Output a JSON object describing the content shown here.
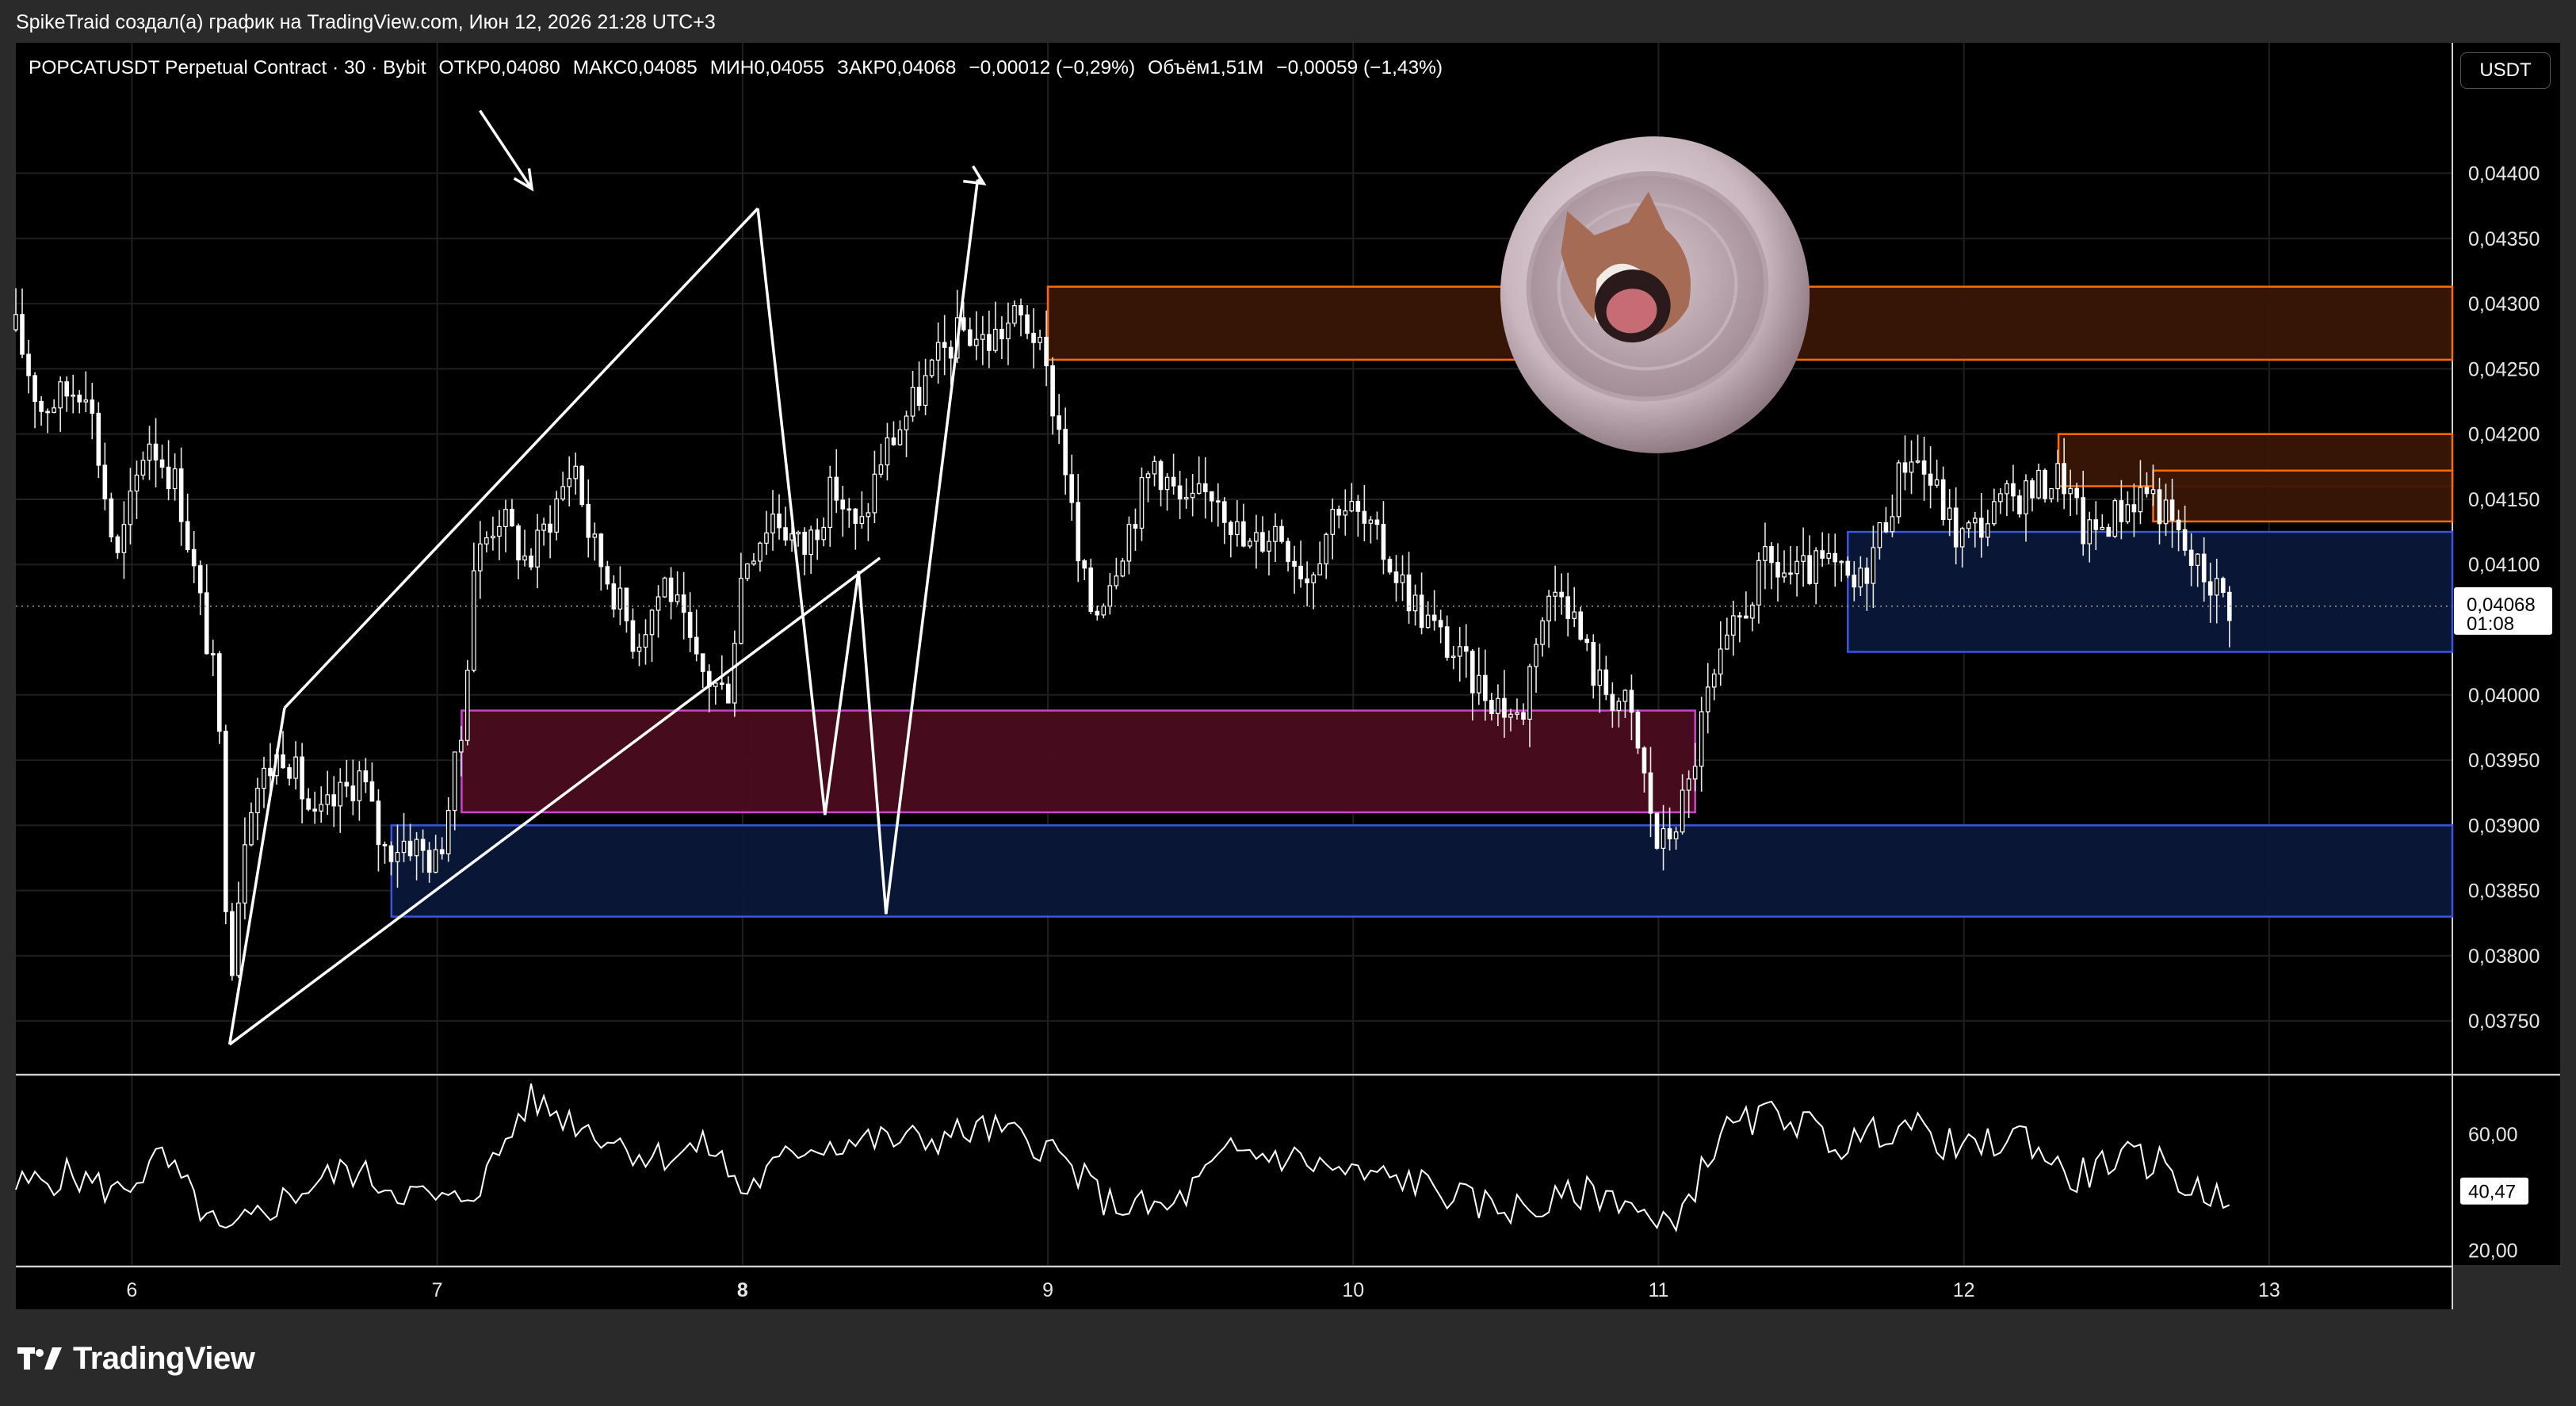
{
  "credit": "SpikeTraid создал(а) график на TradingView.com, Июн 12, 2026 21:28 UTC+3",
  "legend": {
    "symbol": "POPCATUSDT Perpetual Contract · 30 · Bybit",
    "open": "ОТКР0,04080",
    "high": "МАКС0,04085",
    "low": "МИН0,04055",
    "close": "ЗАКР0,04068",
    "change": "−0,00012 (−0,29%)",
    "volume": "Объём1,51M",
    "vol_change": "−0,00059 (−1,43%)"
  },
  "currency": "USDT",
  "brand": "TradingView",
  "chart_data": {
    "type": "candlestick",
    "price_axis": {
      "ylim": [
        0.0371,
        0.045
      ],
      "ticks": [
        "0,04400",
        "0,04350",
        "0,04300",
        "0,04250",
        "0,04200",
        "0,04150",
        "0,04100",
        "0,04000",
        "0,03950",
        "0,03900",
        "0,03850",
        "0,03800",
        "0,03750"
      ],
      "tick_values": [
        0.044,
        0.0435,
        0.043,
        0.0425,
        0.042,
        0.0415,
        0.041,
        0.04,
        0.0395,
        0.039,
        0.0385,
        0.038,
        0.0375
      ],
      "last_price": "0,04068",
      "last_price_value": 0.04068,
      "countdown": "01:08"
    },
    "time_axis": {
      "labels": [
        "6",
        "7",
        "8",
        "9",
        "10",
        "11",
        "12",
        "13"
      ],
      "bold": "8",
      "day_range": [
        5.62,
        13.6
      ]
    },
    "price_series": {
      "knots_day": [
        5.62,
        5.7,
        5.85,
        5.95,
        6.05,
        6.15,
        6.28,
        6.32,
        6.38,
        6.5,
        6.6,
        6.75,
        6.82,
        6.9,
        7.0,
        7.08,
        7.12,
        7.2,
        7.3,
        7.45,
        7.5,
        7.58,
        7.65,
        7.75,
        7.85,
        7.95,
        8.0,
        8.1,
        8.2,
        8.3,
        8.38,
        8.45,
        8.55,
        8.65,
        8.72,
        8.8,
        8.9,
        8.95,
        9.0,
        9.05,
        9.1,
        9.15,
        9.25,
        9.35,
        9.45,
        9.55,
        9.65,
        9.75,
        9.85,
        9.95,
        10.0,
        10.1,
        10.2,
        10.3,
        10.4,
        10.5,
        10.55,
        10.6,
        10.68,
        10.75,
        10.8,
        10.9,
        10.95,
        11.0,
        11.05,
        11.1,
        11.15,
        11.25,
        11.35,
        11.45,
        11.55,
        11.65,
        11.75,
        11.82,
        11.9,
        11.98,
        12.05,
        12.15,
        12.25,
        12.32,
        12.4,
        12.5,
        12.6,
        12.68,
        12.75,
        12.8,
        12.87
      ],
      "knots_close": [
        0.0428,
        0.0422,
        0.0424,
        0.041,
        0.042,
        0.0416,
        0.04,
        0.0378,
        0.0392,
        0.0396,
        0.039,
        0.0394,
        0.0388,
        0.0389,
        0.0387,
        0.0397,
        0.041,
        0.0414,
        0.041,
        0.0418,
        0.0412,
        0.0408,
        0.0404,
        0.0409,
        0.0402,
        0.04,
        0.041,
        0.0414,
        0.0411,
        0.0416,
        0.0412,
        0.0418,
        0.0422,
        0.0426,
        0.0428,
        0.0427,
        0.0429,
        0.0428,
        0.0424,
        0.0419,
        0.041,
        0.0406,
        0.0412,
        0.0418,
        0.0414,
        0.0416,
        0.0411,
        0.0413,
        0.0409,
        0.0415,
        0.0414,
        0.0411,
        0.0407,
        0.0404,
        0.0401,
        0.0399,
        0.0398,
        0.0405,
        0.0409,
        0.0404,
        0.0401,
        0.0399,
        0.0394,
        0.0388,
        0.039,
        0.0393,
        0.0399,
        0.0405,
        0.041,
        0.0409,
        0.041,
        0.0408,
        0.0414,
        0.0419,
        0.0416,
        0.0412,
        0.0413,
        0.0415,
        0.0416,
        0.0417,
        0.0412,
        0.0414,
        0.0416,
        0.0413,
        0.041,
        0.0409,
        0.0407
      ],
      "candles_per_day": 48
    },
    "zones": [
      {
        "color": "#ff6a00",
        "fill": "#3a1606",
        "x": [
          9.0,
          13.6
        ],
        "y": [
          0.04257,
          0.04313
        ]
      },
      {
        "color": "#cc44cc",
        "fill": "#4a0c1e",
        "x": [
          7.08,
          11.12
        ],
        "y": [
          0.0391,
          0.03988
        ]
      },
      {
        "color": "#3a56e0",
        "fill": "#0b1738",
        "x": [
          6.85,
          13.6
        ],
        "y": [
          0.0383,
          0.039
        ]
      },
      {
        "color": "#3a56e0",
        "fill": "#0b1738",
        "x": [
          11.62,
          13.6
        ],
        "y": [
          0.04033,
          0.04125
        ]
      },
      {
        "color": "#ff6a00",
        "fill": "#3a1606",
        "x": [
          12.31,
          13.6
        ],
        "y": [
          0.0416,
          0.042
        ]
      },
      {
        "color": "#ff6a00",
        "fill": "#3a1606",
        "x": [
          12.62,
          13.6
        ],
        "y": [
          0.04133,
          0.04172
        ]
      }
    ],
    "drawings": [
      {
        "name": "triangle-upper-line",
        "pts": [
          [
            6.5,
            0.0399
          ],
          [
            8.05,
            0.04373
          ]
        ]
      },
      {
        "name": "triangle-lower-line",
        "pts": [
          [
            6.32,
            0.03732
          ],
          [
            8.45,
            0.04105
          ]
        ]
      },
      {
        "name": "triangle-left-edge",
        "pts": [
          [
            6.32,
            0.03732
          ],
          [
            6.5,
            0.0399
          ]
        ]
      },
      {
        "name": "zigzag-path",
        "pts": [
          [
            8.05,
            0.04373
          ],
          [
            8.27,
            0.03908
          ],
          [
            8.38,
            0.04095
          ],
          [
            8.47,
            0.03832
          ],
          [
            8.77,
            0.04395
          ]
        ]
      },
      {
        "name": "down-arrow",
        "pts": [
          [
            7.14,
            0.04448
          ],
          [
            7.31,
            0.04388
          ]
        ],
        "head": true
      },
      {
        "name": "up-arrow",
        "pts": [
          [
            8.77,
            0.04395
          ],
          [
            8.79,
            0.04392
          ]
        ],
        "head": true
      }
    ],
    "oscillator": {
      "ylim": [
        15,
        80
      ],
      "ticks": [
        "60,00",
        "20,00"
      ],
      "tick_values": [
        60,
        20
      ],
      "last_value": "40,47",
      "last_value_num": 40.47,
      "knots_day": [
        5.62,
        5.8,
        5.95,
        6.1,
        6.3,
        6.5,
        6.7,
        6.9,
        7.05,
        7.15,
        7.3,
        7.5,
        7.7,
        7.9,
        8.0,
        8.2,
        8.4,
        8.6,
        8.8,
        9.0,
        9.1,
        9.2,
        9.4,
        9.6,
        9.8,
        10.0,
        10.2,
        10.4,
        10.6,
        10.75,
        10.9,
        11.0,
        11.1,
        11.2,
        11.4,
        11.6,
        11.8,
        12.0,
        12.2,
        12.35,
        12.5,
        12.65,
        12.75,
        12.87
      ],
      "knots_value": [
        42,
        46,
        40,
        52,
        24,
        38,
        48,
        40,
        36,
        44,
        72,
        62,
        52,
        56,
        40,
        56,
        58,
        58,
        62,
        56,
        46,
        36,
        34,
        54,
        52,
        46,
        44,
        36,
        34,
        40,
        38,
        26,
        38,
        60,
        68,
        56,
        64,
        54,
        60,
        44,
        52,
        50,
        40,
        40
      ]
    }
  }
}
